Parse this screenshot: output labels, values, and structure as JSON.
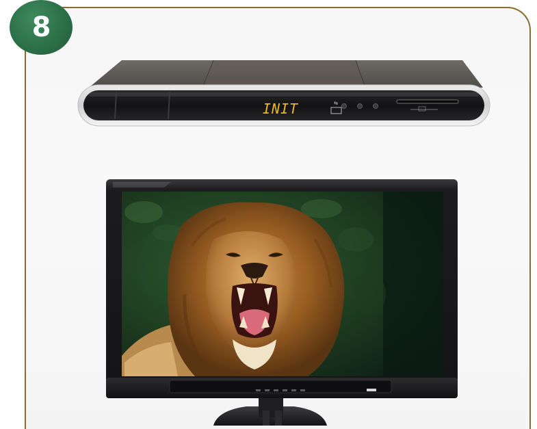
{
  "step": {
    "number": "8"
  },
  "set_top_box": {
    "display_text": "INIT"
  },
  "colors": {
    "badge_green": "#2c7048",
    "panel_border": "#8a6a2e",
    "display_amber": "#e8b820"
  }
}
